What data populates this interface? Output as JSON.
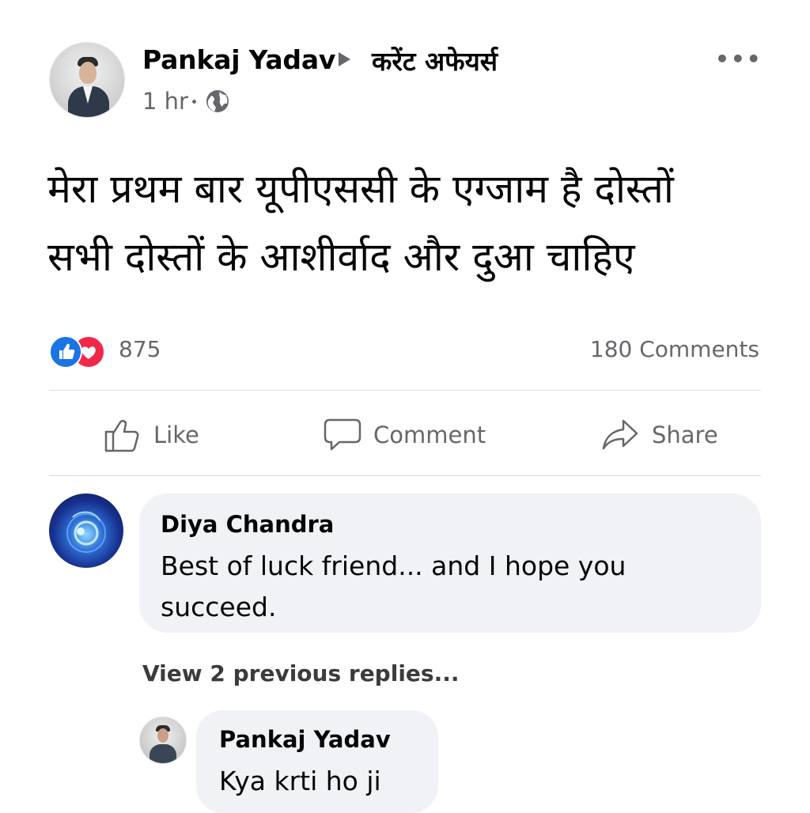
{
  "post": {
    "author": "Pankaj Yadav",
    "group": "करेंट अफेयर्स",
    "time": "1 hr",
    "more": "•••",
    "text_line1": "मेरा प्रथम बार यूपीएससी के एग्जाम है दोस्तों",
    "text_line2": "सभी दोस्तों के आशीर्वाद और दुआ चाहिए"
  },
  "stats": {
    "reaction_count": "875",
    "comments_count": "180 Comments",
    "reactions": [
      "like-icon",
      "love-icon"
    ]
  },
  "actions": {
    "like": "Like",
    "comment": "Comment",
    "share": "Share"
  },
  "comments": [
    {
      "name": "Diya Chandra",
      "text": "Best of luck friend... and I hope you succeed."
    }
  ],
  "view_replies": "View 2 previous replies...",
  "reply": {
    "name": "Pankaj Yadav",
    "text": "Kya krti ho ji"
  },
  "colors": {
    "like_blue": "#1b74e4",
    "love_red": "#f0284a",
    "muted": "#65676b",
    "bubble": "#f0f2f5"
  }
}
